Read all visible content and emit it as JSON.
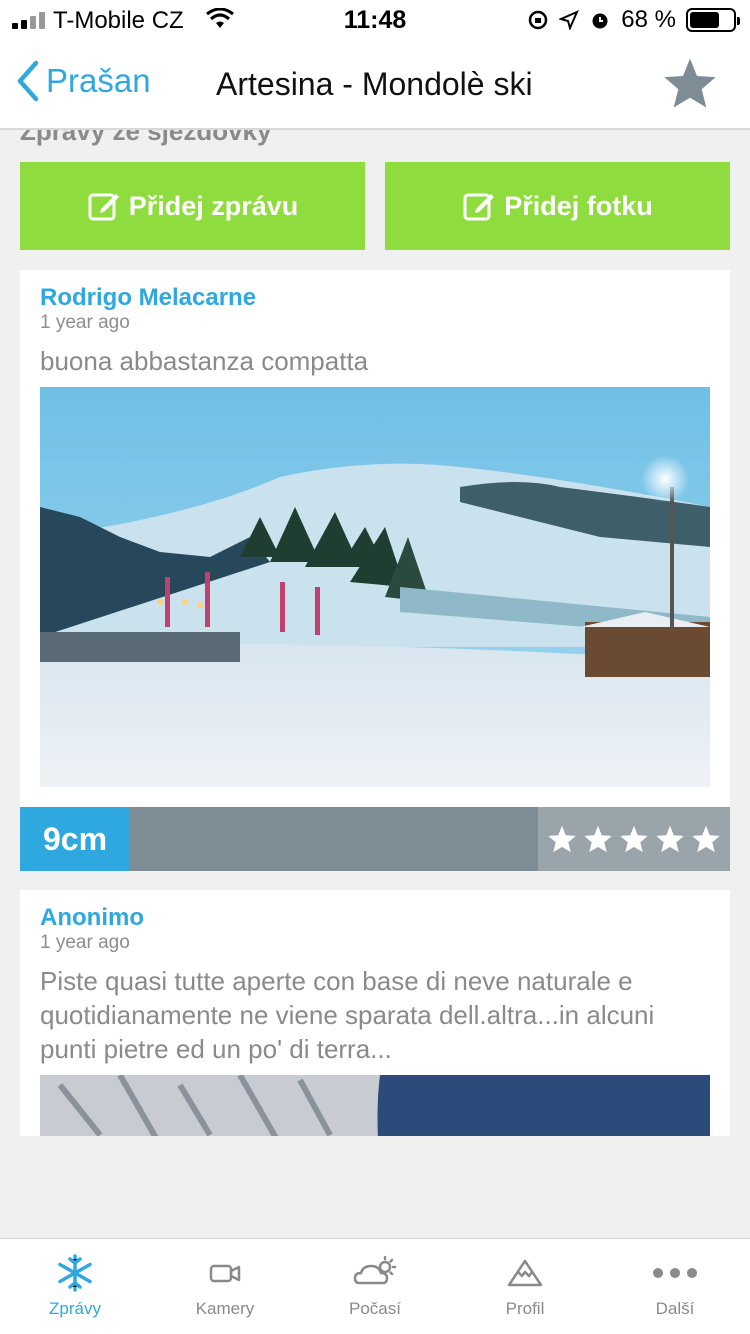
{
  "status_bar": {
    "carrier": "T-Mobile CZ",
    "time": "11:48",
    "battery": "68 %",
    "battery_level": 0.68
  },
  "nav": {
    "back_label": "Prašan",
    "title": "Artesina - Mondolè ski"
  },
  "section": {
    "title": "Zprávy ze sjezdovky"
  },
  "actions": {
    "add_message": "Přidej zprávu",
    "add_photo": "Přidej fotku"
  },
  "reports": [
    {
      "author": "Rodrigo Melacarne",
      "time_ago": "1 year ago",
      "message": "buona abbastanza compatta",
      "snow_depth": "9cm",
      "rating": 5
    },
    {
      "author": "Anonimo",
      "time_ago": "1 year ago",
      "message": "Piste quasi tutte aperte con base di neve naturale e quotidianamente ne viene sparata dell.altra...in alcuni punti pietre ed un po' di terra..."
    }
  ],
  "tabs": [
    {
      "label": "Zprávy",
      "icon": "snowflake-icon",
      "active": true
    },
    {
      "label": "Kamery",
      "icon": "camera-icon",
      "active": false
    },
    {
      "label": "Počasí",
      "icon": "weather-icon",
      "active": false
    },
    {
      "label": "Profil",
      "icon": "mountain-icon",
      "active": false
    },
    {
      "label": "Další",
      "icon": "more-icon",
      "active": false
    }
  ],
  "colors": {
    "accent": "#2fa8e0",
    "green": "#8fdc3f",
    "stats_bar": "#7e8c96"
  }
}
